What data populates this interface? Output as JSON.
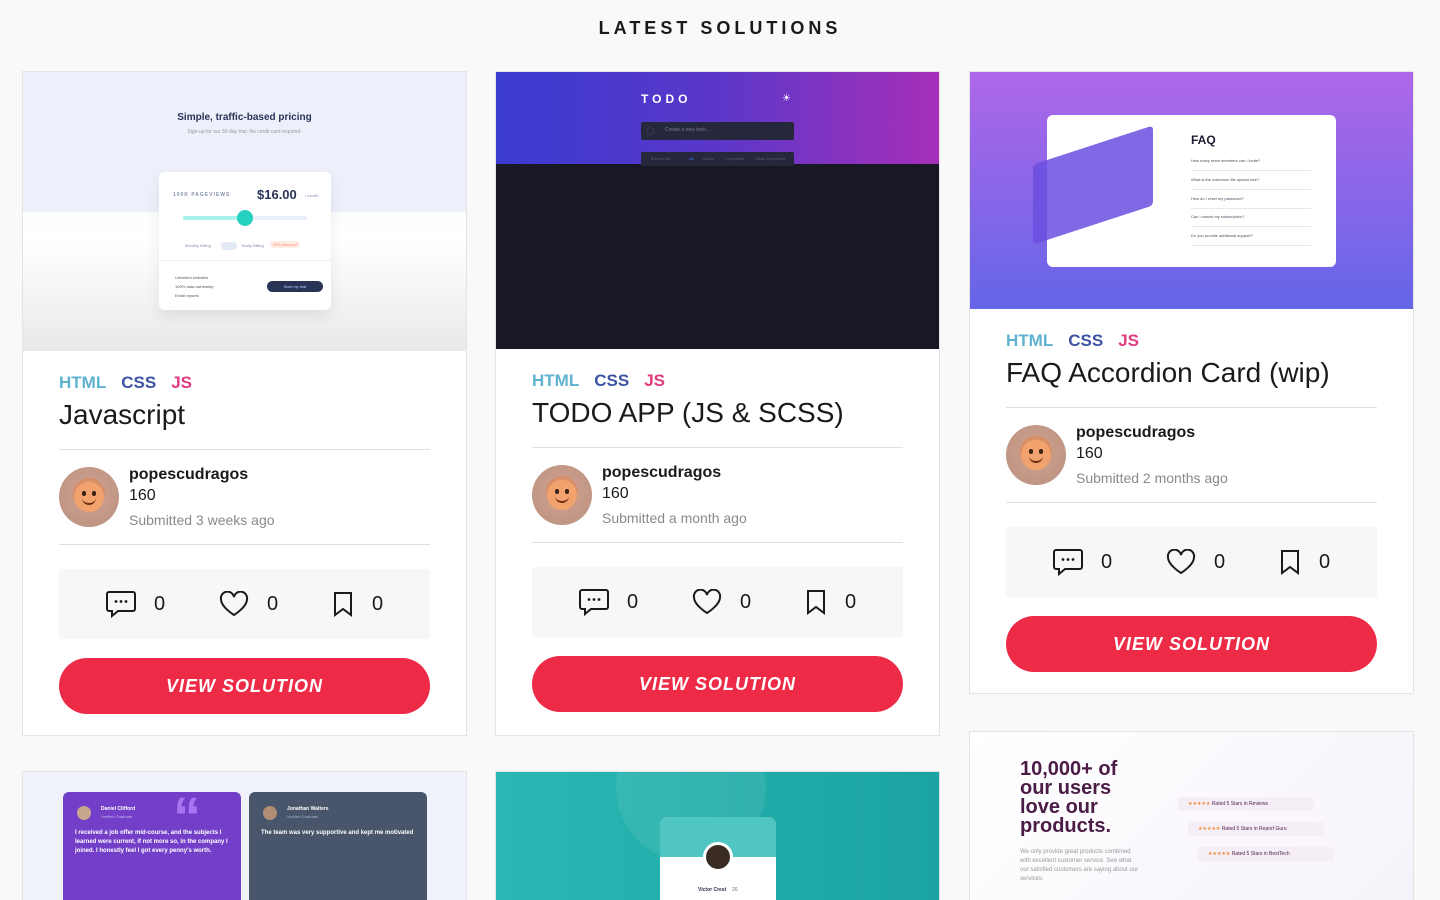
{
  "page": {
    "heading": "LATEST SOLUTIONS"
  },
  "colors": {
    "background": "#f9f9f9",
    "accent": "#ee2b47",
    "tag_html": "#5fb3d1",
    "tag_css": "#3e54a3",
    "tag_js": "#e23b82"
  },
  "cards": [
    {
      "tags": [
        "HTML",
        "CSS",
        "JS"
      ],
      "title": "Javascript",
      "author": "popescudragos",
      "score": "160",
      "submitted": "Submitted 3 weeks ago",
      "comments": "0",
      "likes": "0",
      "bookmarks": "0",
      "button": "VIEW SOLUTION",
      "preview": {
        "heading": "Simple, traffic-based pricing",
        "subheading": "Sign-up for our 30-day trial. No credit card required.",
        "pageviews": "100K PAGEVIEWS",
        "price": "$16.00",
        "per": "/ month",
        "monthly": "Monthly Billing",
        "yearly": "Yearly Billing",
        "discount": "25% discount",
        "features": [
          "Unlimited websites",
          "100% data ownership",
          "Email reports"
        ],
        "trial_button": "Start my trial"
      }
    },
    {
      "tags": [
        "HTML",
        "CSS",
        "JS"
      ],
      "title": "TODO APP (JS & SCSS)",
      "author": "popescudragos",
      "score": "160",
      "submitted": "Submitted a month ago",
      "comments": "0",
      "likes": "0",
      "bookmarks": "0",
      "button": "VIEW SOLUTION",
      "preview": {
        "logo": "TODO",
        "input_placeholder": "Create a new todo...",
        "items_left": "5 items left",
        "filter_all": "All",
        "filter_active": "Active",
        "filter_completed": "Completed",
        "clear": "Clear Completed"
      }
    },
    {
      "tags": [
        "HTML",
        "CSS",
        "JS"
      ],
      "title": "FAQ Accordion Card (wip)",
      "author": "popescudragos",
      "score": "160",
      "submitted": "Submitted 2 months ago",
      "comments": "0",
      "likes": "0",
      "bookmarks": "0",
      "button": "VIEW SOLUTION",
      "preview": {
        "heading": "FAQ",
        "questions": [
          "How many team members can I invite?",
          "What is the maximum file upload size?",
          "How do I reset my password?",
          "Can I cancel my subscription?",
          "Do you provide additional support?"
        ]
      }
    }
  ],
  "previews_row2": {
    "testimonials": {
      "name1": "Daniel Clifford",
      "role1": "Verified Graduate",
      "quote1": "I received a job offer mid-course, and the subjects I learned were current, if not more so, in the company I joined. I honestly feel I got every penny's worth.",
      "name2": "Jonathan Walters",
      "role2": "Verified Graduate",
      "quote2": "The team was very supportive and kept me motivated"
    },
    "profile": {
      "name": "Victor Crest",
      "age": "26"
    },
    "social_proof": {
      "headline": "10,000+ of our users love our products.",
      "body": "We only provide great products combined with excellent customer service. See what our satisfied customers are saying about our services.",
      "ratings": [
        "Rated 5 Stars in Reviews",
        "Rated 5 Stars in Report Guru",
        "Rated 5 Stars in BestTech"
      ]
    }
  }
}
